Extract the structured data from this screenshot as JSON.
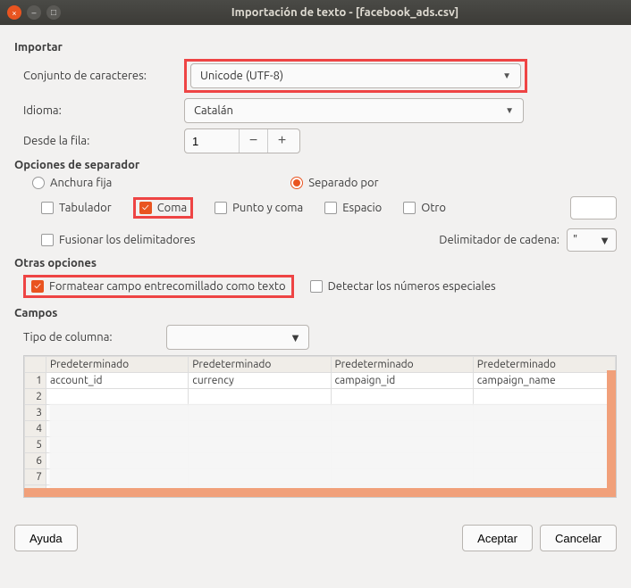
{
  "window": {
    "title": "Importación de texto - [facebook_ads.csv]"
  },
  "sections": {
    "import": "Importar",
    "separator": "Opciones de separador",
    "other": "Otras opciones",
    "fields": "Campos"
  },
  "labels": {
    "charset": "Conjunto de caracteres:",
    "language": "Idioma:",
    "from_row": "Desde la fila:",
    "column_type": "Tipo de columna:",
    "string_delim": "Delimitador de cadena:"
  },
  "values": {
    "charset": "Unicode (UTF-8)",
    "language": "Catalán",
    "from_row": "1",
    "string_delim": "\""
  },
  "radio": {
    "fixed": "Anchura fija",
    "separated": "Separado por"
  },
  "sep": {
    "tab": "Tabulador",
    "comma": "Coma",
    "semicolon": "Punto y coma",
    "space": "Espacio",
    "other": "Otro",
    "merge": "Fusionar los delimitadores"
  },
  "options": {
    "quoted": "Formatear campo entrecomillado como texto",
    "detect": "Detectar los números especiales"
  },
  "preview": {
    "default": "Predeterminado",
    "headers": [
      "account_id",
      "currency",
      "campaign_id",
      "campaign_name"
    ]
  },
  "buttons": {
    "help": "Ayuda",
    "ok": "Aceptar",
    "cancel": "Cancelar"
  }
}
